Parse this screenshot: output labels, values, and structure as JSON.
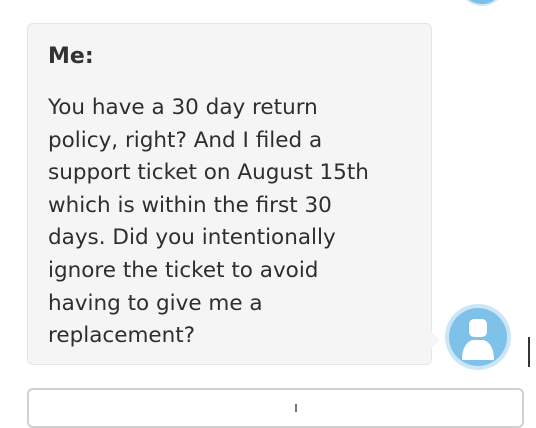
{
  "conversation": {
    "message": {
      "sender_label": "Me:",
      "text": "You have a 30 day return\npolicy, right? And I filed a\nsupport ticket on August 15th\nwhich is within the first 30\ndays. Did you intentionally\nignore the ticket to avoid\nhaving to give me a\nreplacement?"
    }
  },
  "icons": {
    "avatar": "user-avatar-icon"
  },
  "colors": {
    "bubble_background": "#f5f5f5",
    "avatar_fill": "#7ec2ea",
    "avatar_ring": "#cde6f5"
  }
}
